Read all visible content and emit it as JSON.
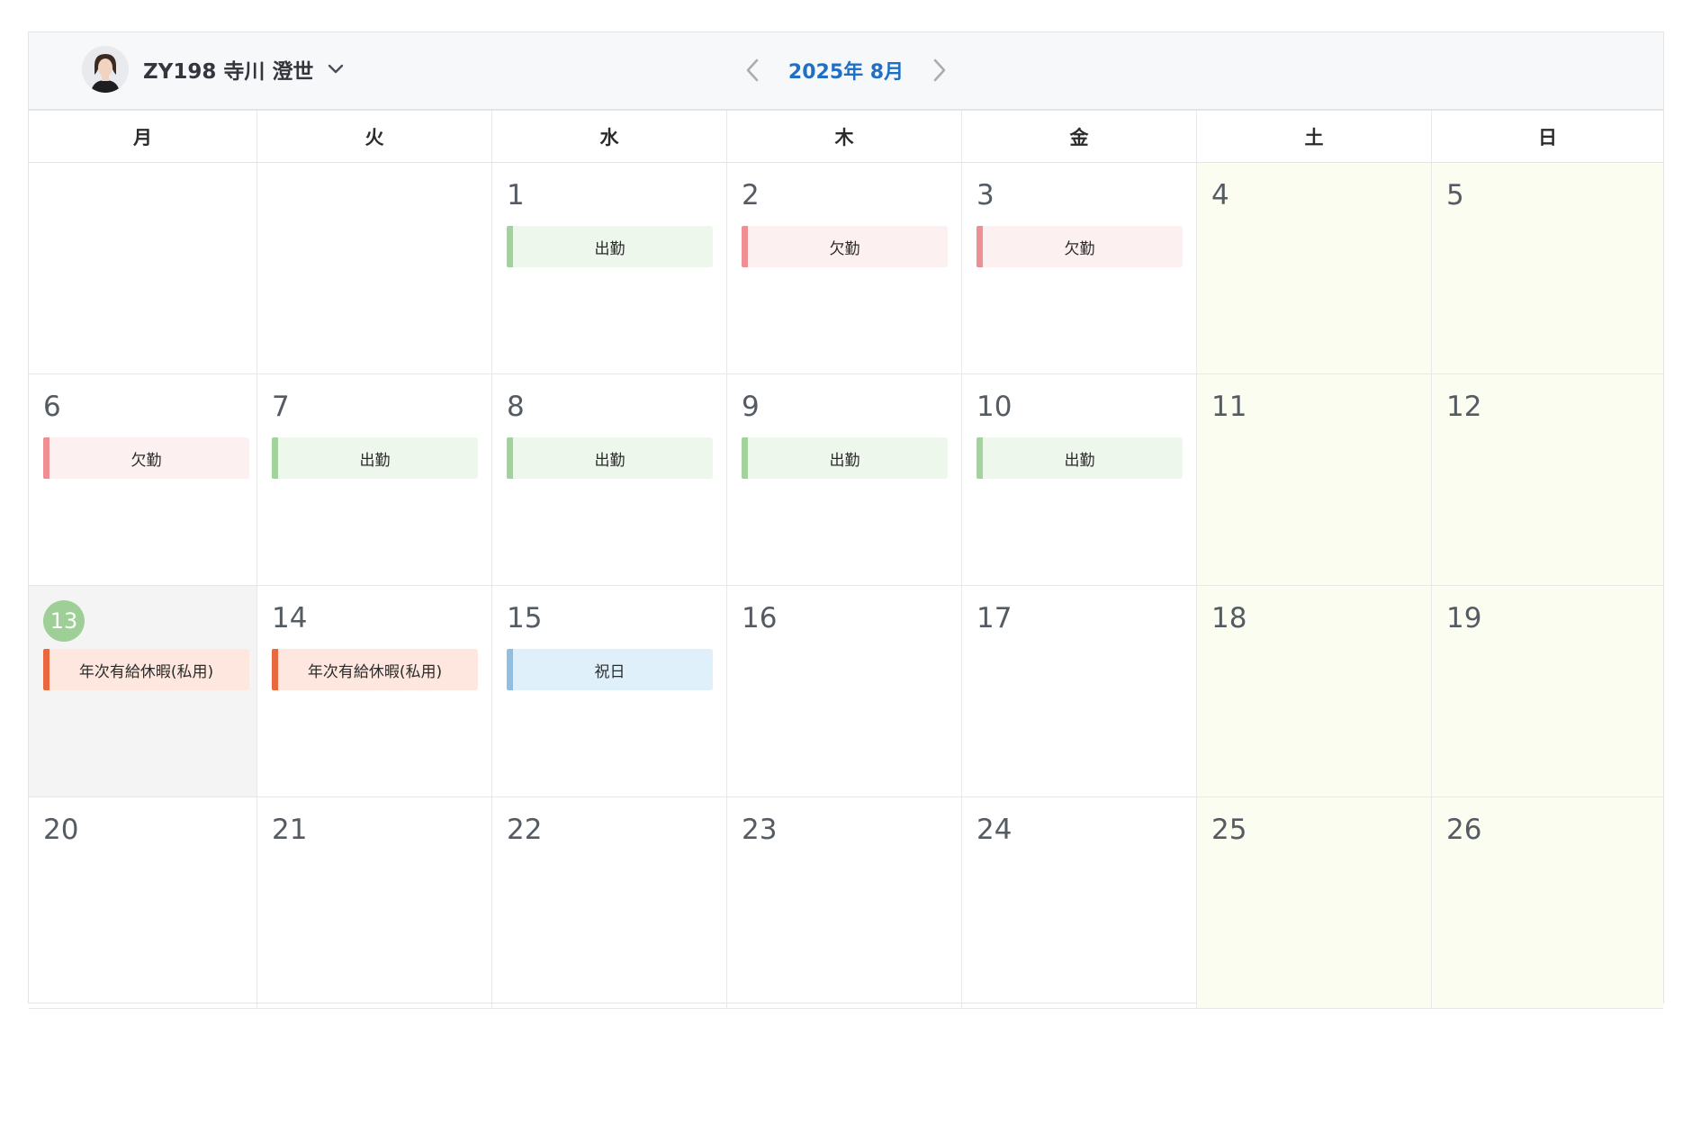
{
  "header": {
    "user_name": "ZY198 寺川 澄世",
    "month_label": "2025年 8月"
  },
  "weekdays": [
    "月",
    "火",
    "水",
    "木",
    "金",
    "土",
    "日"
  ],
  "event_styles": {
    "出勤": {
      "bg": "#eef7ec",
      "bar": "#a3d39c"
    },
    "欠勤": {
      "bg": "#fdf0f0",
      "bar": "#ee8f93"
    },
    "年次有給休暇(私用)": {
      "bg": "#fde7df",
      "bar": "#e9683f"
    },
    "祝日": {
      "bg": "#e0f0fb",
      "bar": "#8fc0e3"
    }
  },
  "colors": {
    "accent": "#1f6fc4",
    "weekend_bg": "#fcfdf1",
    "today_bg": "#f4f4f4",
    "today_badge": "#9ecf96"
  },
  "weeks": [
    [
      {
        "day": ""
      },
      {
        "day": ""
      },
      {
        "day": "1",
        "event": "出勤"
      },
      {
        "day": "2",
        "event": "欠勤"
      },
      {
        "day": "3",
        "event": "欠勤"
      },
      {
        "day": "4"
      },
      {
        "day": "5"
      }
    ],
    [
      {
        "day": "6",
        "event": "欠勤"
      },
      {
        "day": "7",
        "event": "出勤"
      },
      {
        "day": "8",
        "event": "出勤"
      },
      {
        "day": "9",
        "event": "出勤"
      },
      {
        "day": "10",
        "event": "出勤"
      },
      {
        "day": "11"
      },
      {
        "day": "12"
      }
    ],
    [
      {
        "day": "13",
        "event": "年次有給休暇(私用)",
        "today": true
      },
      {
        "day": "14",
        "event": "年次有給休暇(私用)"
      },
      {
        "day": "15",
        "event": "祝日"
      },
      {
        "day": "16"
      },
      {
        "day": "17"
      },
      {
        "day": "18"
      },
      {
        "day": "19"
      }
    ],
    [
      {
        "day": "20"
      },
      {
        "day": "21"
      },
      {
        "day": "22"
      },
      {
        "day": "23"
      },
      {
        "day": "24"
      },
      {
        "day": "25"
      },
      {
        "day": "26"
      }
    ]
  ]
}
